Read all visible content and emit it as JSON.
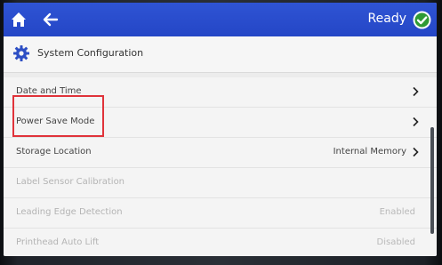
{
  "topbar": {
    "status": "Ready",
    "home_icon": "home-icon",
    "back_icon": "back-arrow-icon",
    "status_icon": "check-circle-icon",
    "bar_color": "#2446c6"
  },
  "header": {
    "title": "System Configuration",
    "icon": "gear-icon"
  },
  "menu": [
    {
      "label": "Date and Time",
      "value": "",
      "chevron": true,
      "enabled": true
    },
    {
      "label": "Power Save Mode",
      "value": "",
      "chevron": true,
      "enabled": true
    },
    {
      "label": "Storage Location",
      "value": "Internal Memory",
      "chevron": true,
      "enabled": true
    },
    {
      "label": "Label Sensor Calibration",
      "value": "",
      "chevron": false,
      "enabled": false
    },
    {
      "label": "Leading Edge Detection",
      "value": "Enabled",
      "chevron": false,
      "enabled": false
    },
    {
      "label": "Printhead Auto Lift",
      "value": "Disabled",
      "chevron": false,
      "enabled": false
    }
  ],
  "annotation_color": "#e0333a"
}
